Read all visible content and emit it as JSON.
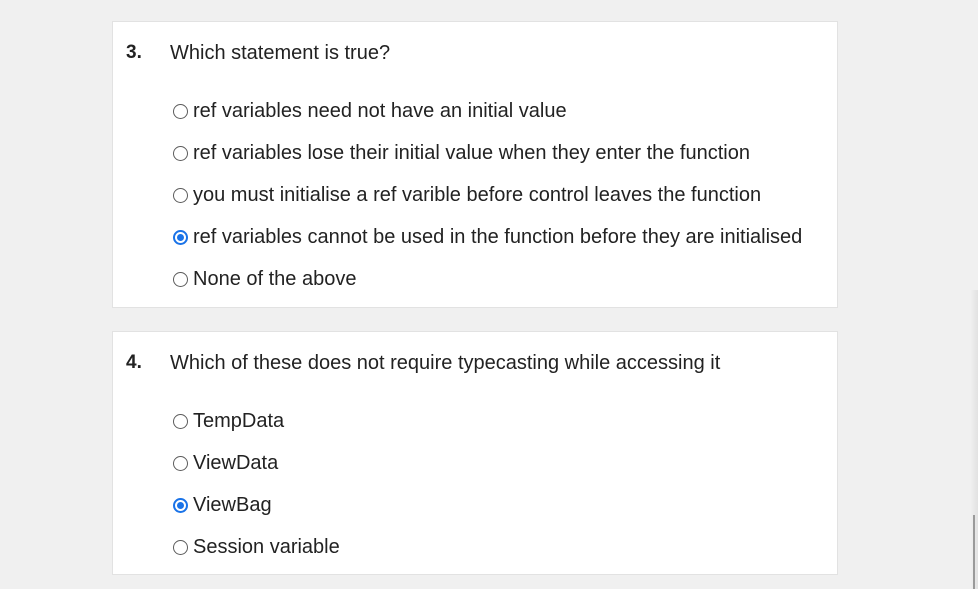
{
  "questions": [
    {
      "number": "3.",
      "text": "Which statement is true?",
      "options": [
        {
          "label": "ref variables need not have an initial value",
          "selected": false
        },
        {
          "label": "ref variables lose their initial value when they enter the function",
          "selected": false
        },
        {
          "label": "you must initialise a ref varible before control leaves the function",
          "selected": false
        },
        {
          "label": "ref variables cannot be used in the function before they are initialised",
          "selected": true
        },
        {
          "label": "None of the above",
          "selected": false
        }
      ]
    },
    {
      "number": "4.",
      "text": "Which of these does not require typecasting while accessing it",
      "options": [
        {
          "label": "TempData",
          "selected": false
        },
        {
          "label": "ViewData",
          "selected": false
        },
        {
          "label": "ViewBag",
          "selected": true
        },
        {
          "label": "Session variable",
          "selected": false
        }
      ]
    }
  ],
  "colors": {
    "accent": "#1a73e8",
    "page_background": "#f0f0f0",
    "card_background": "#ffffff"
  }
}
